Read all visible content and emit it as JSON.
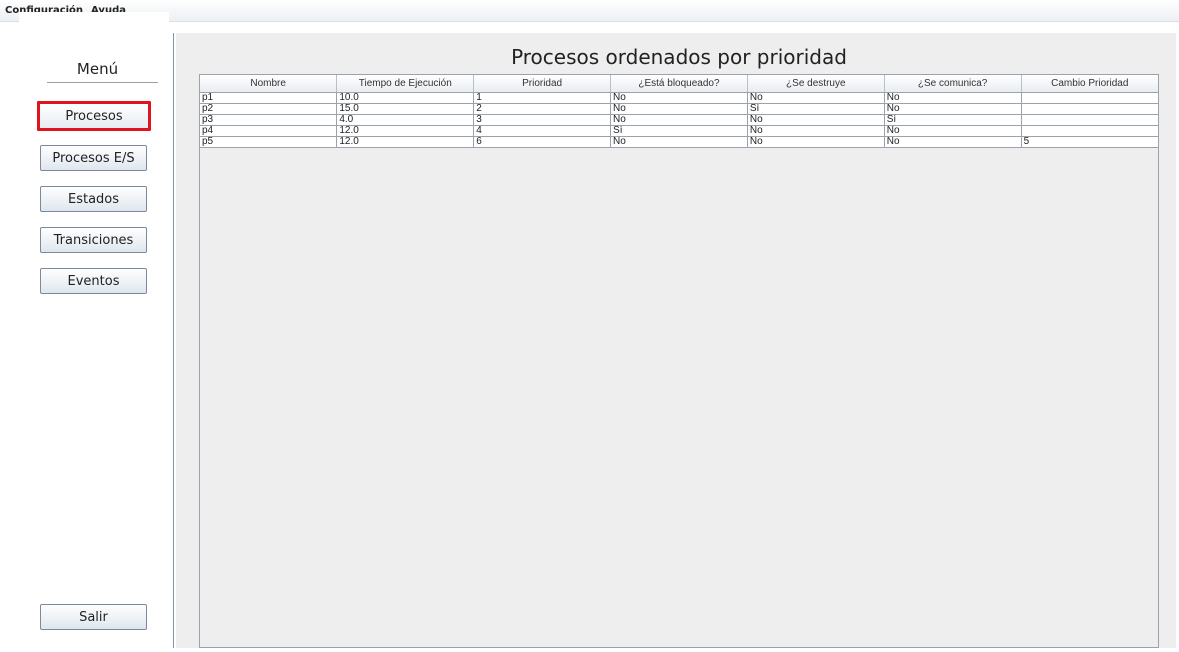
{
  "menubar": {
    "items": [
      "Configuración",
      "Ayuda"
    ]
  },
  "sidebar": {
    "title": "Menú",
    "buttons": [
      "Procesos",
      "Procesos E/S",
      "Estados",
      "Transiciones",
      "Eventos"
    ],
    "selected": "Procesos",
    "exit": "Salir"
  },
  "main": {
    "title": "Procesos ordenados por prioridad",
    "table": {
      "columns": [
        "Nombre",
        "Tiempo de Ejecución",
        "Prioridad",
        "¿Está bloqueado?",
        "¿Se destruye",
        "¿Se comunica?",
        "Cambio Prioridad"
      ],
      "rows": [
        [
          "p1",
          "10.0",
          "1",
          "No",
          "No",
          "No",
          ""
        ],
        [
          "p2",
          "15.0",
          "2",
          "No",
          "Sí",
          "No",
          ""
        ],
        [
          "p3",
          "4.0",
          "3",
          "No",
          "No",
          "Sí",
          ""
        ],
        [
          "p4",
          "12.0",
          "4",
          "Sí",
          "No",
          "No",
          ""
        ],
        [
          "p5",
          "12.0",
          "6",
          "No",
          "No",
          "No",
          "5"
        ]
      ]
    }
  },
  "colors": {
    "selection_border": "#e0141e",
    "content_bg": "#eeeeee"
  }
}
